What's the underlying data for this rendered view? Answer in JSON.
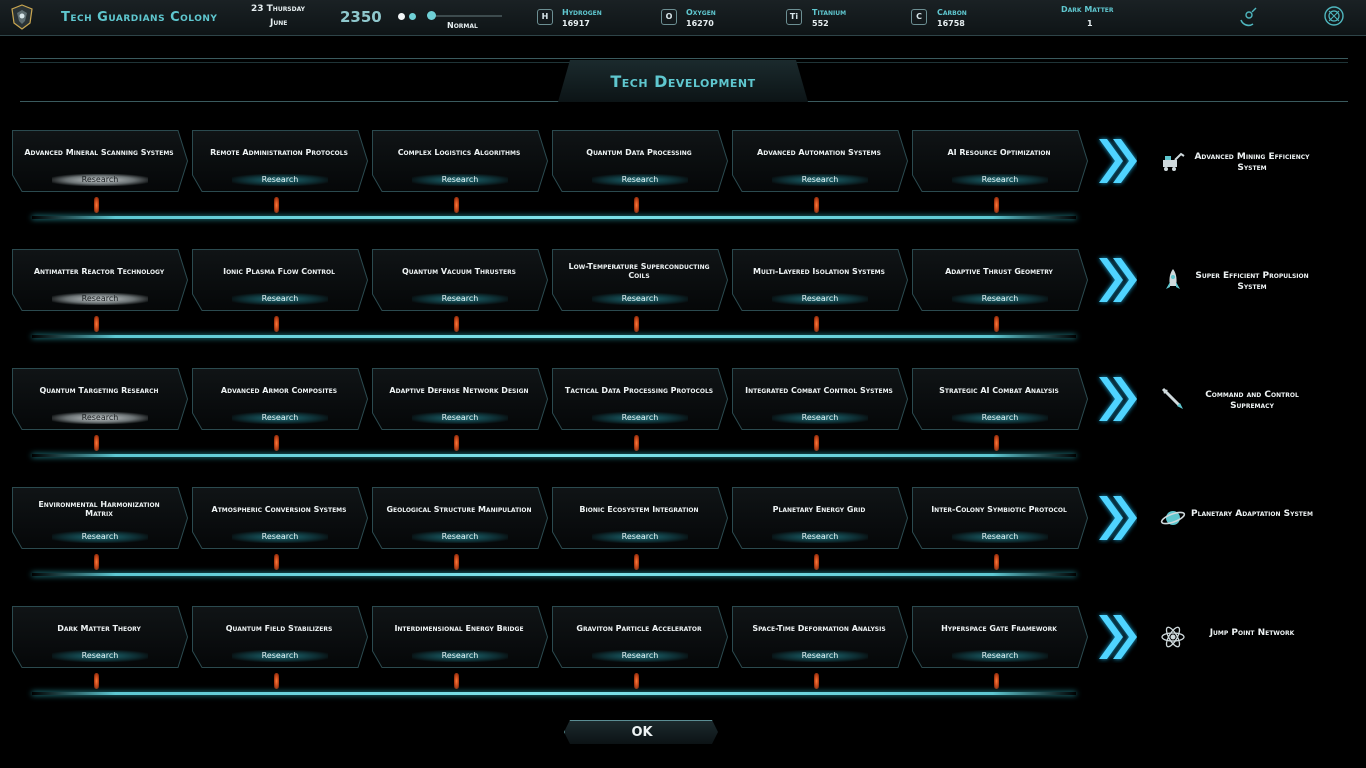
{
  "topbar": {
    "colony_name": "Tech Guardians Colony",
    "date_line1": "23 Thursday",
    "date_line2": "June",
    "year": "2350",
    "speed_label": "Normal",
    "resources": [
      {
        "symbol": "H",
        "name": "Hydrogen",
        "value": "16917"
      },
      {
        "symbol": "O",
        "name": "Oxygen",
        "value": "16270"
      },
      {
        "symbol": "Ti",
        "name": "Titanium",
        "value": "552"
      },
      {
        "symbol": "C",
        "name": "Carbon",
        "value": "16758"
      }
    ],
    "dark_matter": {
      "name": "Dark Matter",
      "value": "1"
    }
  },
  "page_title": "Tech Development",
  "rows": [
    {
      "techs": [
        {
          "name": "Advanced Mineral Scanning Systems",
          "button": "Research"
        },
        {
          "name": "Remote Administration Protocols",
          "button": "Research"
        },
        {
          "name": "Complex Logistics Algorithms",
          "button": "Research"
        },
        {
          "name": "Quantum Data Processing",
          "button": "Research"
        },
        {
          "name": "Advanced Automation Systems",
          "button": "Research"
        },
        {
          "name": "AI Resource Optimization",
          "button": "Research"
        }
      ],
      "result": "Advanced Mining Efficiency System",
      "result_icon": "mining-rover-icon"
    },
    {
      "techs": [
        {
          "name": "Antimatter Reactor Technology",
          "button": "Research"
        },
        {
          "name": "Ionic Plasma Flow Control",
          "button": "Research"
        },
        {
          "name": "Quantum Vacuum Thrusters",
          "button": "Research"
        },
        {
          "name": "Low-Temperature Superconducting Coils",
          "button": "Research"
        },
        {
          "name": "Multi-Layered Isolation Systems",
          "button": "Research"
        },
        {
          "name": "Adaptive Thrust Geometry",
          "button": "Research"
        }
      ],
      "result": "Super Efficient Propulsion System",
      "result_icon": "rocket-icon"
    },
    {
      "techs": [
        {
          "name": "Quantum Targeting Research",
          "button": "Research"
        },
        {
          "name": "Advanced Armor Composites",
          "button": "Research"
        },
        {
          "name": "Adaptive Defense Network Design",
          "button": "Research"
        },
        {
          "name": "Tactical Data Processing Protocols",
          "button": "Research"
        },
        {
          "name": "Integrated Combat Control Systems",
          "button": "Research"
        },
        {
          "name": "Strategic AI Combat Analysis",
          "button": "Research"
        }
      ],
      "result": "Command and Control Supremacy",
      "result_icon": "missile-icon"
    },
    {
      "techs": [
        {
          "name": "Environmental Harmonization Matrix",
          "button": "Research"
        },
        {
          "name": "Atmospheric Conversion Systems",
          "button": "Research"
        },
        {
          "name": "Geological Structure Manipulation",
          "button": "Research"
        },
        {
          "name": "Bionic Ecosystem Integration",
          "button": "Research"
        },
        {
          "name": "Planetary Energy Grid",
          "button": "Research"
        },
        {
          "name": "Inter-Colony Symbiotic Protocol",
          "button": "Research"
        }
      ],
      "result": "Planetary Adaptation System",
      "result_icon": "planet-icon"
    },
    {
      "techs": [
        {
          "name": "Dark Matter Theory",
          "button": "Research"
        },
        {
          "name": "Quantum Field Stabilizers",
          "button": "Research"
        },
        {
          "name": "Interdimensional Energy Bridge",
          "button": "Research"
        },
        {
          "name": "Graviton Particle Accelerator",
          "button": "Research"
        },
        {
          "name": "Space-Time Deformation Analysis",
          "button": "Research"
        },
        {
          "name": "Hyperspace Gate Framework",
          "button": "Research"
        }
      ],
      "result": "Jump Point Network",
      "result_icon": "atom-icon"
    }
  ],
  "ok_label": "OK",
  "colors": {
    "accent": "#5fc7cf",
    "glow": "#29c6f0",
    "pin": "#d2461a"
  }
}
